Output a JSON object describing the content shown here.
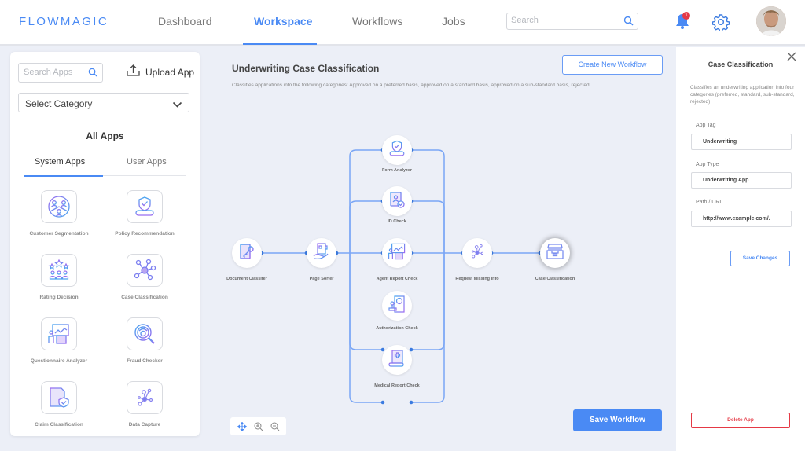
{
  "header": {
    "logo": "FLOWMAGIC",
    "nav": [
      {
        "label": "Dashboard",
        "active": false
      },
      {
        "label": "Workspace",
        "active": true
      },
      {
        "label": "Workflows",
        "active": false
      },
      {
        "label": "Jobs",
        "active": false
      }
    ],
    "search_placeholder": "Search",
    "notification_count": "1",
    "icons": {
      "search": "search-icon",
      "bell": "bell-icon",
      "settings": "gear-icon",
      "avatar": "user-avatar"
    }
  },
  "left_panel": {
    "search_placeholder": "Search Apps",
    "upload_label": "Upload App",
    "category_label": "Select Category",
    "section_title": "All Apps",
    "tabs": [
      {
        "label": "System Apps",
        "active": true
      },
      {
        "label": "User Apps",
        "active": false
      }
    ],
    "apps": [
      {
        "name": "Customer Segmentation",
        "icon": "customer-segmentation-icon"
      },
      {
        "name": "Policy Recommendation",
        "icon": "policy-recommendation-icon"
      },
      {
        "name": "Rating Decision",
        "icon": "rating-decision-icon"
      },
      {
        "name": "Case Classification",
        "icon": "case-classification-icon"
      },
      {
        "name": "Questionnaire Analyzer",
        "icon": "questionnaire-analyzer-icon"
      },
      {
        "name": "Fraud Checker",
        "icon": "fraud-checker-icon"
      },
      {
        "name": "Claim Classification",
        "icon": "claim-classification-icon"
      },
      {
        "name": "Data Capture",
        "icon": "data-capture-icon"
      }
    ]
  },
  "canvas": {
    "title": "Underwriting Case Classification",
    "description": "Classifies applications into the following categories: Approved on a preferred basis, approved on a standard basis, approved on a sub-standard basis, rejected",
    "create_button": "Create New Workflow",
    "save_button": "Save Workflow",
    "tools": [
      "move-icon",
      "zoom-in-icon",
      "zoom-out-icon"
    ],
    "nodes": [
      {
        "id": "doc",
        "label": "Document Classifer",
        "icon": "document-classifier-icon"
      },
      {
        "id": "page",
        "label": "Page Sorter",
        "icon": "page-sorter-icon"
      },
      {
        "id": "form",
        "label": "Form Analyzer",
        "icon": "form-analyzer-icon"
      },
      {
        "id": "idc",
        "label": "ID Check",
        "icon": "id-check-icon"
      },
      {
        "id": "agent",
        "label": "Agent Report Check",
        "icon": "agent-report-icon"
      },
      {
        "id": "auth",
        "label": "Authorization  Check",
        "icon": "authorization-check-icon"
      },
      {
        "id": "med",
        "label": "Medical Report  Check",
        "icon": "medical-report-icon"
      },
      {
        "id": "req",
        "label": "Request Missing info",
        "icon": "request-missing-info-icon"
      },
      {
        "id": "case",
        "label": "Case Classification",
        "icon": "case-classification-icon",
        "selected": true
      }
    ]
  },
  "right_panel": {
    "title": "Case Classification",
    "description": "Classifies an underwriting application into four categories (preferred, standard, sub-standard, rejected)",
    "fields": [
      {
        "label": "App Tag",
        "value": "Underwriting"
      },
      {
        "label": "App Type",
        "value": "Underwriting App"
      },
      {
        "label": "Path / URL",
        "value": "http://www.example.com/."
      }
    ],
    "save_button": "Save Changes",
    "delete_button": "Delete App"
  }
}
